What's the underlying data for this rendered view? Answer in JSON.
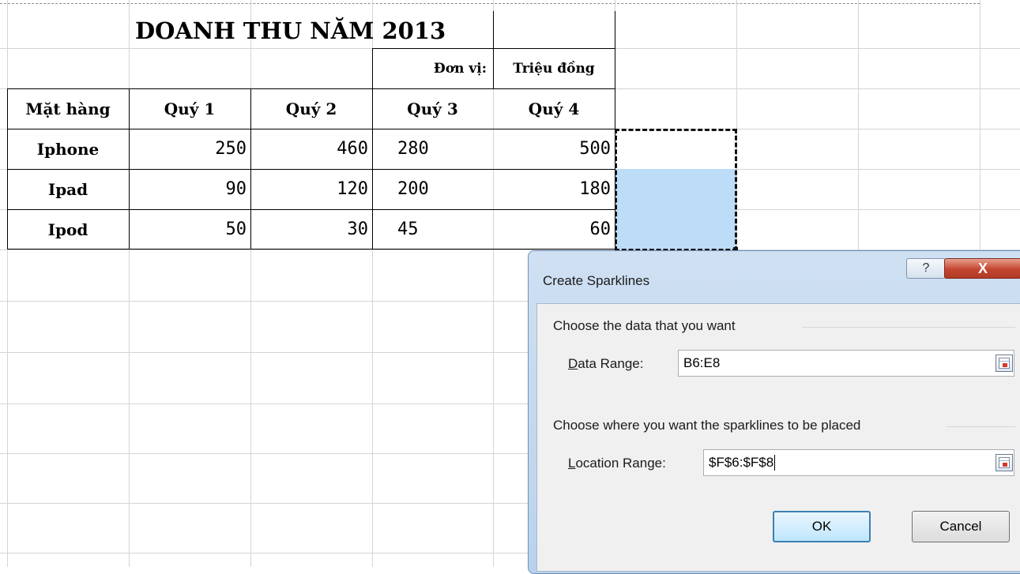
{
  "sheet": {
    "title": "DOANH THU NĂM 2013",
    "unit_label": "Đơn vị:",
    "unit_value": "Triệu đồng",
    "headers": [
      "Mặt hàng",
      "Quý 1",
      "Quý 2",
      "Quý 3",
      "Quý 4"
    ],
    "rows": [
      {
        "item": "Iphone",
        "values": [
          "250",
          "460",
          "280",
          "500"
        ]
      },
      {
        "item": "Ipad",
        "values": [
          "90",
          "120",
          "200",
          "180"
        ]
      },
      {
        "item": "Ipod",
        "values": [
          "50",
          "30",
          "45",
          "60"
        ]
      }
    ]
  },
  "dialog": {
    "title": "Create Sparklines",
    "help_icon": "?",
    "close_icon": "X",
    "group1": "Choose the data that you want",
    "data_range_label_u": "D",
    "data_range_label_rest": "ata Range:",
    "data_range_value": "B6:E8",
    "group2": "Choose where you want the sparklines to be placed",
    "location_range_label_u": "L",
    "location_range_label_rest": "ocation Range:",
    "location_range_value": "$F$6:$F$8",
    "ok": "OK",
    "cancel": "Cancel"
  },
  "colors": {
    "selection": "#bcdcf8",
    "grid": "#d4d4d4",
    "close_button": "#c3462f"
  }
}
